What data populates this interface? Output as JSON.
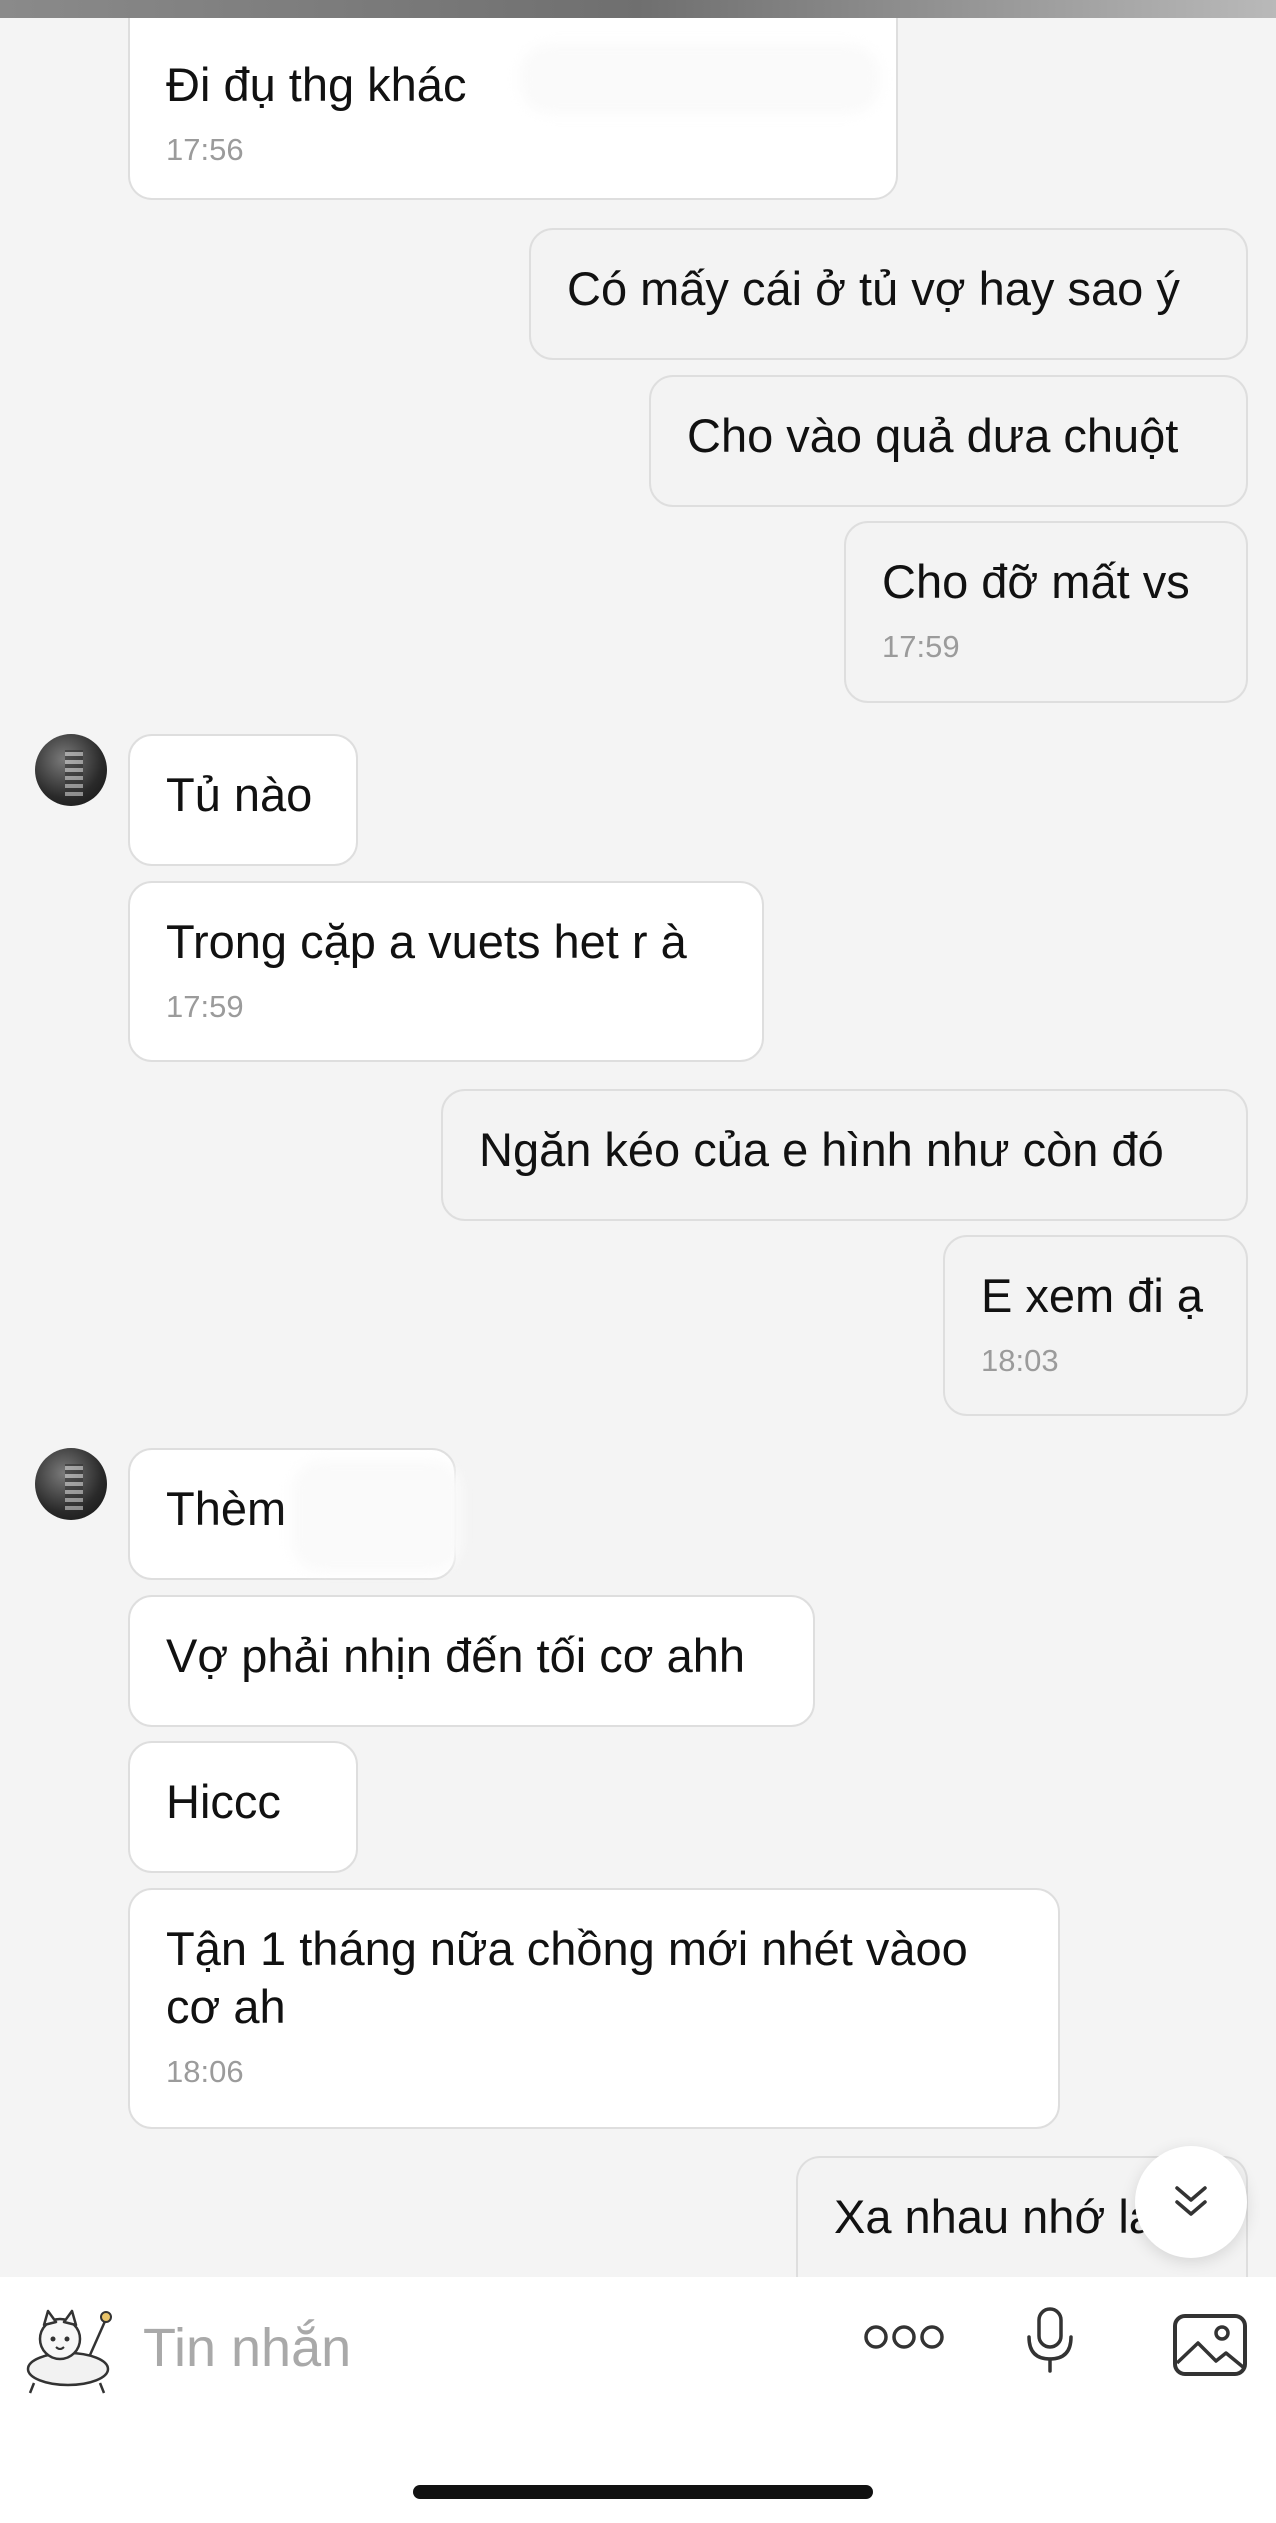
{
  "messages": [
    {
      "side": "in",
      "text": "Đi đụ thg khác",
      "time": "17:56"
    },
    {
      "side": "out",
      "text": "Có mấy cái ở tủ vợ hay sao ý"
    },
    {
      "side": "out",
      "text": "Cho vào quả dưa chuột"
    },
    {
      "side": "out",
      "text": "Cho đỡ mất vs",
      "time": "17:59"
    },
    {
      "side": "in",
      "text": "Tủ nào"
    },
    {
      "side": "in",
      "text": "Trong cặp a vuets het r à",
      "time": "17:59"
    },
    {
      "side": "out",
      "text": "Ngăn kéo của e hình như còn đó"
    },
    {
      "side": "out",
      "text": "E xem đi ạ",
      "time": "18:03"
    },
    {
      "side": "in",
      "text": "Thèm"
    },
    {
      "side": "in",
      "text": "Vợ phải nhịn đến tối cơ ahh"
    },
    {
      "side": "in",
      "text": "Hiccc"
    },
    {
      "side": "in",
      "text": "Tận 1 tháng nữa chồng mới nhét vàoo cơ ah",
      "time": "18:06"
    },
    {
      "side": "out",
      "text": "Xa nhau nhớ la"
    }
  ],
  "composer": {
    "placeholder": "Tin nhắn",
    "icons": [
      "sticker-icon",
      "more-icon",
      "microphone-icon",
      "image-icon"
    ]
  },
  "scroll_button": {
    "icon": "double-chevron-down-icon"
  }
}
